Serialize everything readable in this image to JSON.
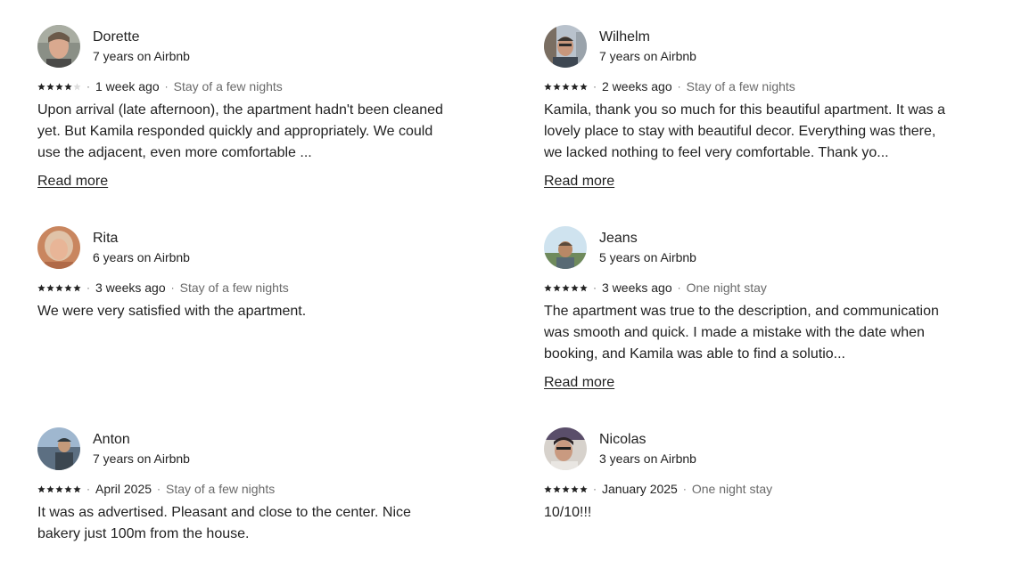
{
  "colors": {
    "star_filled": "#222222",
    "star_empty": "#dddddd",
    "secondary_text": "#6a6a6a",
    "primary_text": "#222222"
  },
  "read_more_label": "Read more",
  "reviews": [
    {
      "name": "Dorette",
      "tenure": "7 years on Airbnb",
      "rating": 4,
      "date": "1 week ago",
      "stay": "Stay of a few nights",
      "comment": "Upon arrival (late afternoon), the apartment hadn't been cleaned yet. But Kamila responded quickly and appropriately. We could use the adjacent, even more comfortable ...",
      "has_read_more": true
    },
    {
      "name": "Wilhelm",
      "tenure": "7 years on Airbnb",
      "rating": 5,
      "date": "2 weeks ago",
      "stay": "Stay of a few nights",
      "comment": "Kamila, thank you so much for this beautiful apartment. It was a lovely place to stay with beautiful decor. Everything was there, we lacked nothing to feel very comfortable. Thank yo...",
      "has_read_more": true
    },
    {
      "name": "Rita",
      "tenure": "6 years on Airbnb",
      "rating": 5,
      "date": "3 weeks ago",
      "stay": "Stay of a few nights",
      "comment": "We were very satisfied with the apartment.",
      "has_read_more": false
    },
    {
      "name": "Jeans",
      "tenure": "5 years on Airbnb",
      "rating": 5,
      "date": "3 weeks ago",
      "stay": "One night stay",
      "comment": "The apartment was true to the description, and communication was smooth and quick. I made a mistake with the date when booking, and Kamila was able to find a solutio...",
      "has_read_more": true
    },
    {
      "name": "Anton",
      "tenure": "7 years on Airbnb",
      "rating": 5,
      "date": "April 2025",
      "stay": "Stay of a few nights",
      "comment": "It was as advertised. Pleasant and close to the center. Nice bakery just 100m from the house.",
      "has_read_more": false
    },
    {
      "name": "Nicolas",
      "tenure": "3 years on Airbnb",
      "rating": 5,
      "date": "January 2025",
      "stay": "One night stay",
      "comment": "10/10!!!",
      "has_read_more": false
    }
  ]
}
